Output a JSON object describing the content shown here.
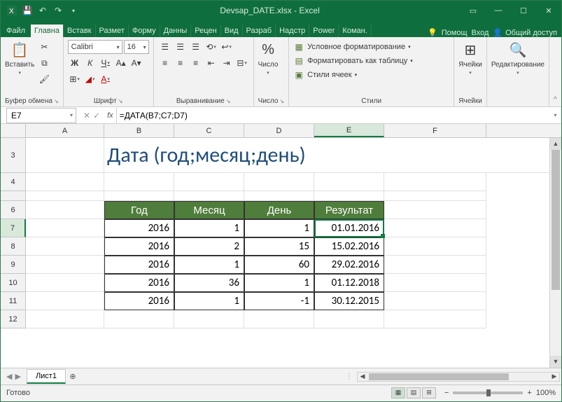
{
  "title": "Devsap_DATE.xlsx - Excel",
  "tabs": {
    "file": "Файл",
    "home": "Главна",
    "insert": "Вставк",
    "layout": "Размет",
    "formulas": "Форму",
    "data": "Данны",
    "review": "Рецен",
    "view": "Вид",
    "dev": "Разраб",
    "addins": "Надстр",
    "power": "Power",
    "team": "Коман.",
    "help": "Помощ",
    "login": "Вход",
    "share": "Общий доступ"
  },
  "ribbon": {
    "clipboard": {
      "paste": "Вставить",
      "label": "Буфер обмена"
    },
    "font": {
      "name": "Calibri",
      "size": "16",
      "label": "Шрифт",
      "bold": "Ж",
      "italic": "К",
      "underline": "Ч"
    },
    "align": {
      "label": "Выравнивание"
    },
    "number": {
      "btn": "Число",
      "label": "Число",
      "percent": "%"
    },
    "styles": {
      "cond": "Условное форматирование",
      "table": "Форматировать как таблицу",
      "cell": "Стили ячеек",
      "label": "Стили"
    },
    "cells": {
      "btn": "Ячейки",
      "label": "Ячейки"
    },
    "editing": {
      "btn": "Редактирование",
      "label": ""
    }
  },
  "namebox": "E7",
  "formula": "=ДАТА(B7;C7;D7)",
  "sheet": {
    "title": "Дата (год;месяц;день)",
    "cols": [
      "A",
      "B",
      "C",
      "D",
      "E",
      "F"
    ],
    "rowlabels": [
      "3",
      "4",
      "",
      "6",
      "7",
      "8",
      "9",
      "10",
      "11",
      "12"
    ],
    "headers": {
      "b": "Год",
      "c": "Месяц",
      "d": "День",
      "e": "Результат"
    },
    "rows": [
      {
        "b": "2016",
        "c": "1",
        "d": "1",
        "e": "01.01.2016"
      },
      {
        "b": "2016",
        "c": "2",
        "d": "15",
        "e": "15.02.2016"
      },
      {
        "b": "2016",
        "c": "1",
        "d": "60",
        "e": "29.02.2016"
      },
      {
        "b": "2016",
        "c": "36",
        "d": "1",
        "e": "01.12.2018"
      },
      {
        "b": "2016",
        "c": "1",
        "d": "-1",
        "e": "30.12.2015"
      }
    ]
  },
  "sheettab": "Лист1",
  "status": {
    "ready": "Готово",
    "zoom": "100%"
  }
}
